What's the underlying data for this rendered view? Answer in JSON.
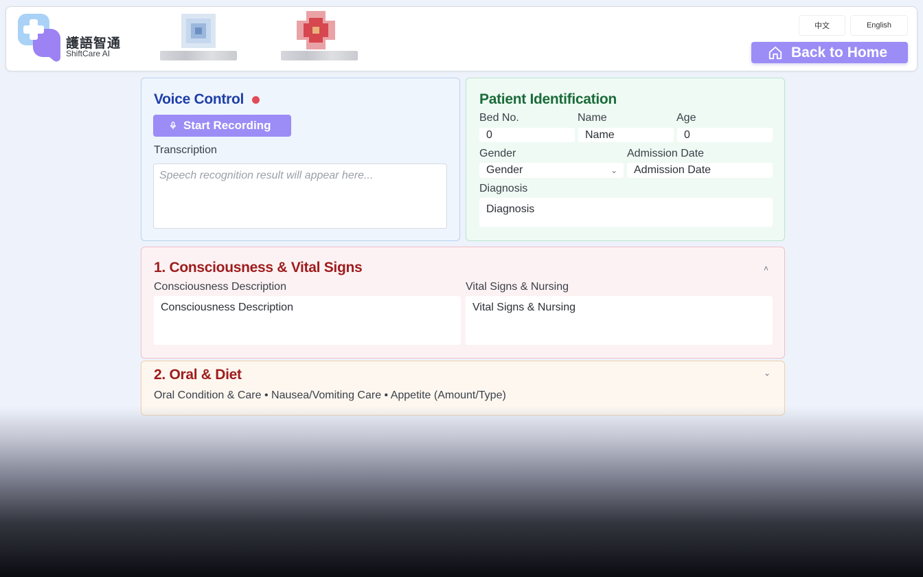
{
  "header": {
    "brand_zh": "護語智通",
    "brand_en": "ShiftCare AI",
    "lang_zh": "中文",
    "lang_en": "English",
    "home_label": "Back to Home"
  },
  "voice": {
    "title": "Voice Control",
    "record_label": "Start Recording",
    "transcription_label": "Transcription",
    "transcription_placeholder": "Speech recognition result will appear here..."
  },
  "patient": {
    "title": "Patient Identification",
    "bed_label": "Bed No.",
    "bed_value": "0",
    "name_label": "Name",
    "name_value": "Name",
    "age_label": "Age",
    "age_value": "0",
    "gender_label": "Gender",
    "gender_value": "Gender",
    "admission_label": "Admission Date",
    "admission_value": "Admission Date",
    "diagnosis_label": "Diagnosis",
    "diagnosis_value": "Diagnosis"
  },
  "section1": {
    "title": "1. Consciousness & Vital Signs",
    "consciousness_label": "Consciousness Description",
    "consciousness_value": "Consciousness Description",
    "vitals_label": "Vital Signs & Nursing",
    "vitals_value": "Vital Signs & Nursing"
  },
  "section2": {
    "title": "2. Oral & Diet",
    "summary": "Oral Condition & Care • Nausea/Vomiting Care • Appetite (Amount/Type)"
  },
  "colors": {
    "accent": "#9c8cf6",
    "voice_title": "#1f3fa8",
    "patient_title": "#1a6b3a",
    "section_title": "#9e1c1c",
    "record_dot": "#e04b57"
  }
}
